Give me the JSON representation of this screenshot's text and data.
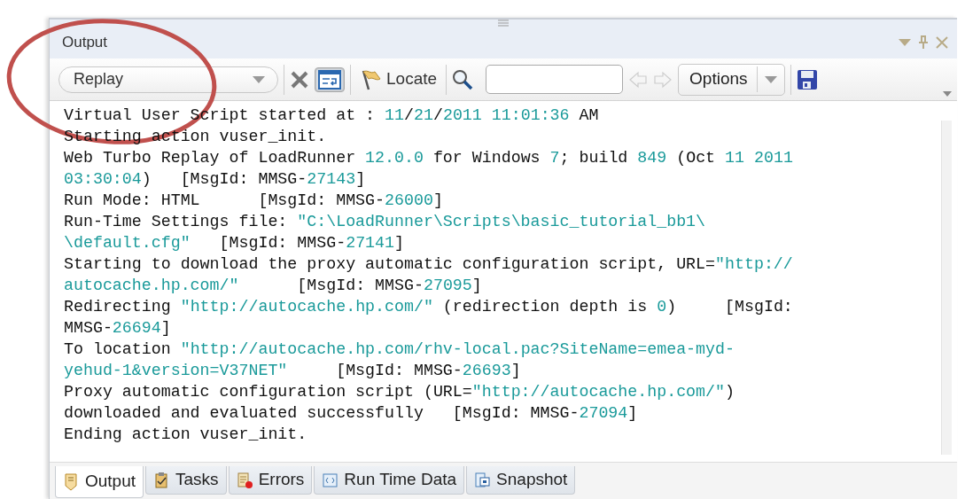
{
  "panel": {
    "title": "Output"
  },
  "toolbar": {
    "filter": {
      "value": "Replay"
    },
    "wrap_toggle": {
      "pressed": true
    },
    "locate_label": "Locate",
    "history_nav": {
      "disabled": true
    },
    "options_label": "Options"
  },
  "log_lines": [
    "Virtual User Script started at : 11/21/2011 11:01:36 AM",
    "Starting action vuser_init.",
    "Web Turbo Replay of LoadRunner 12.0.0 for Windows 7; build 849 (Oct 11 2011",
    "03:30:04)   [MsgId: MMSG-27143]",
    "Run Mode: HTML      [MsgId: MMSG-26000]",
    "Run-Time Settings file: \"C:\\LoadRunner\\Scripts\\basic_tutorial_bb1\\",
    "\\default.cfg\"   [MsgId: MMSG-27141]",
    "Starting to download the proxy automatic configuration script, URL=\"http://",
    "autocache.hp.com/\"      [MsgId: MMSG-27095]",
    "Redirecting \"http://autocache.hp.com/\" (redirection depth is 0)     [MsgId:",
    "MMSG-26694]",
    "To location \"http://autocache.hp.com/rhv-local.pac?SiteName=emea-myd-",
    "yehud-1&version=V37NET\"     [MsgId: MMSG-26693]",
    "Proxy automatic configuration script (URL=\"http://autocache.hp.com/\")",
    "downloaded and evaluated successfully   [MsgId: MMSG-27094]",
    "Ending action vuser_init."
  ],
  "tabs": [
    {
      "label": "Output",
      "kind": "output",
      "selected": true
    },
    {
      "label": "Tasks",
      "kind": "tasks",
      "selected": false
    },
    {
      "label": "Errors",
      "kind": "errors",
      "selected": false
    },
    {
      "label": "Run Time Data",
      "kind": "data",
      "selected": false
    },
    {
      "label": "Snapshot",
      "kind": "snapshot",
      "selected": false
    }
  ]
}
